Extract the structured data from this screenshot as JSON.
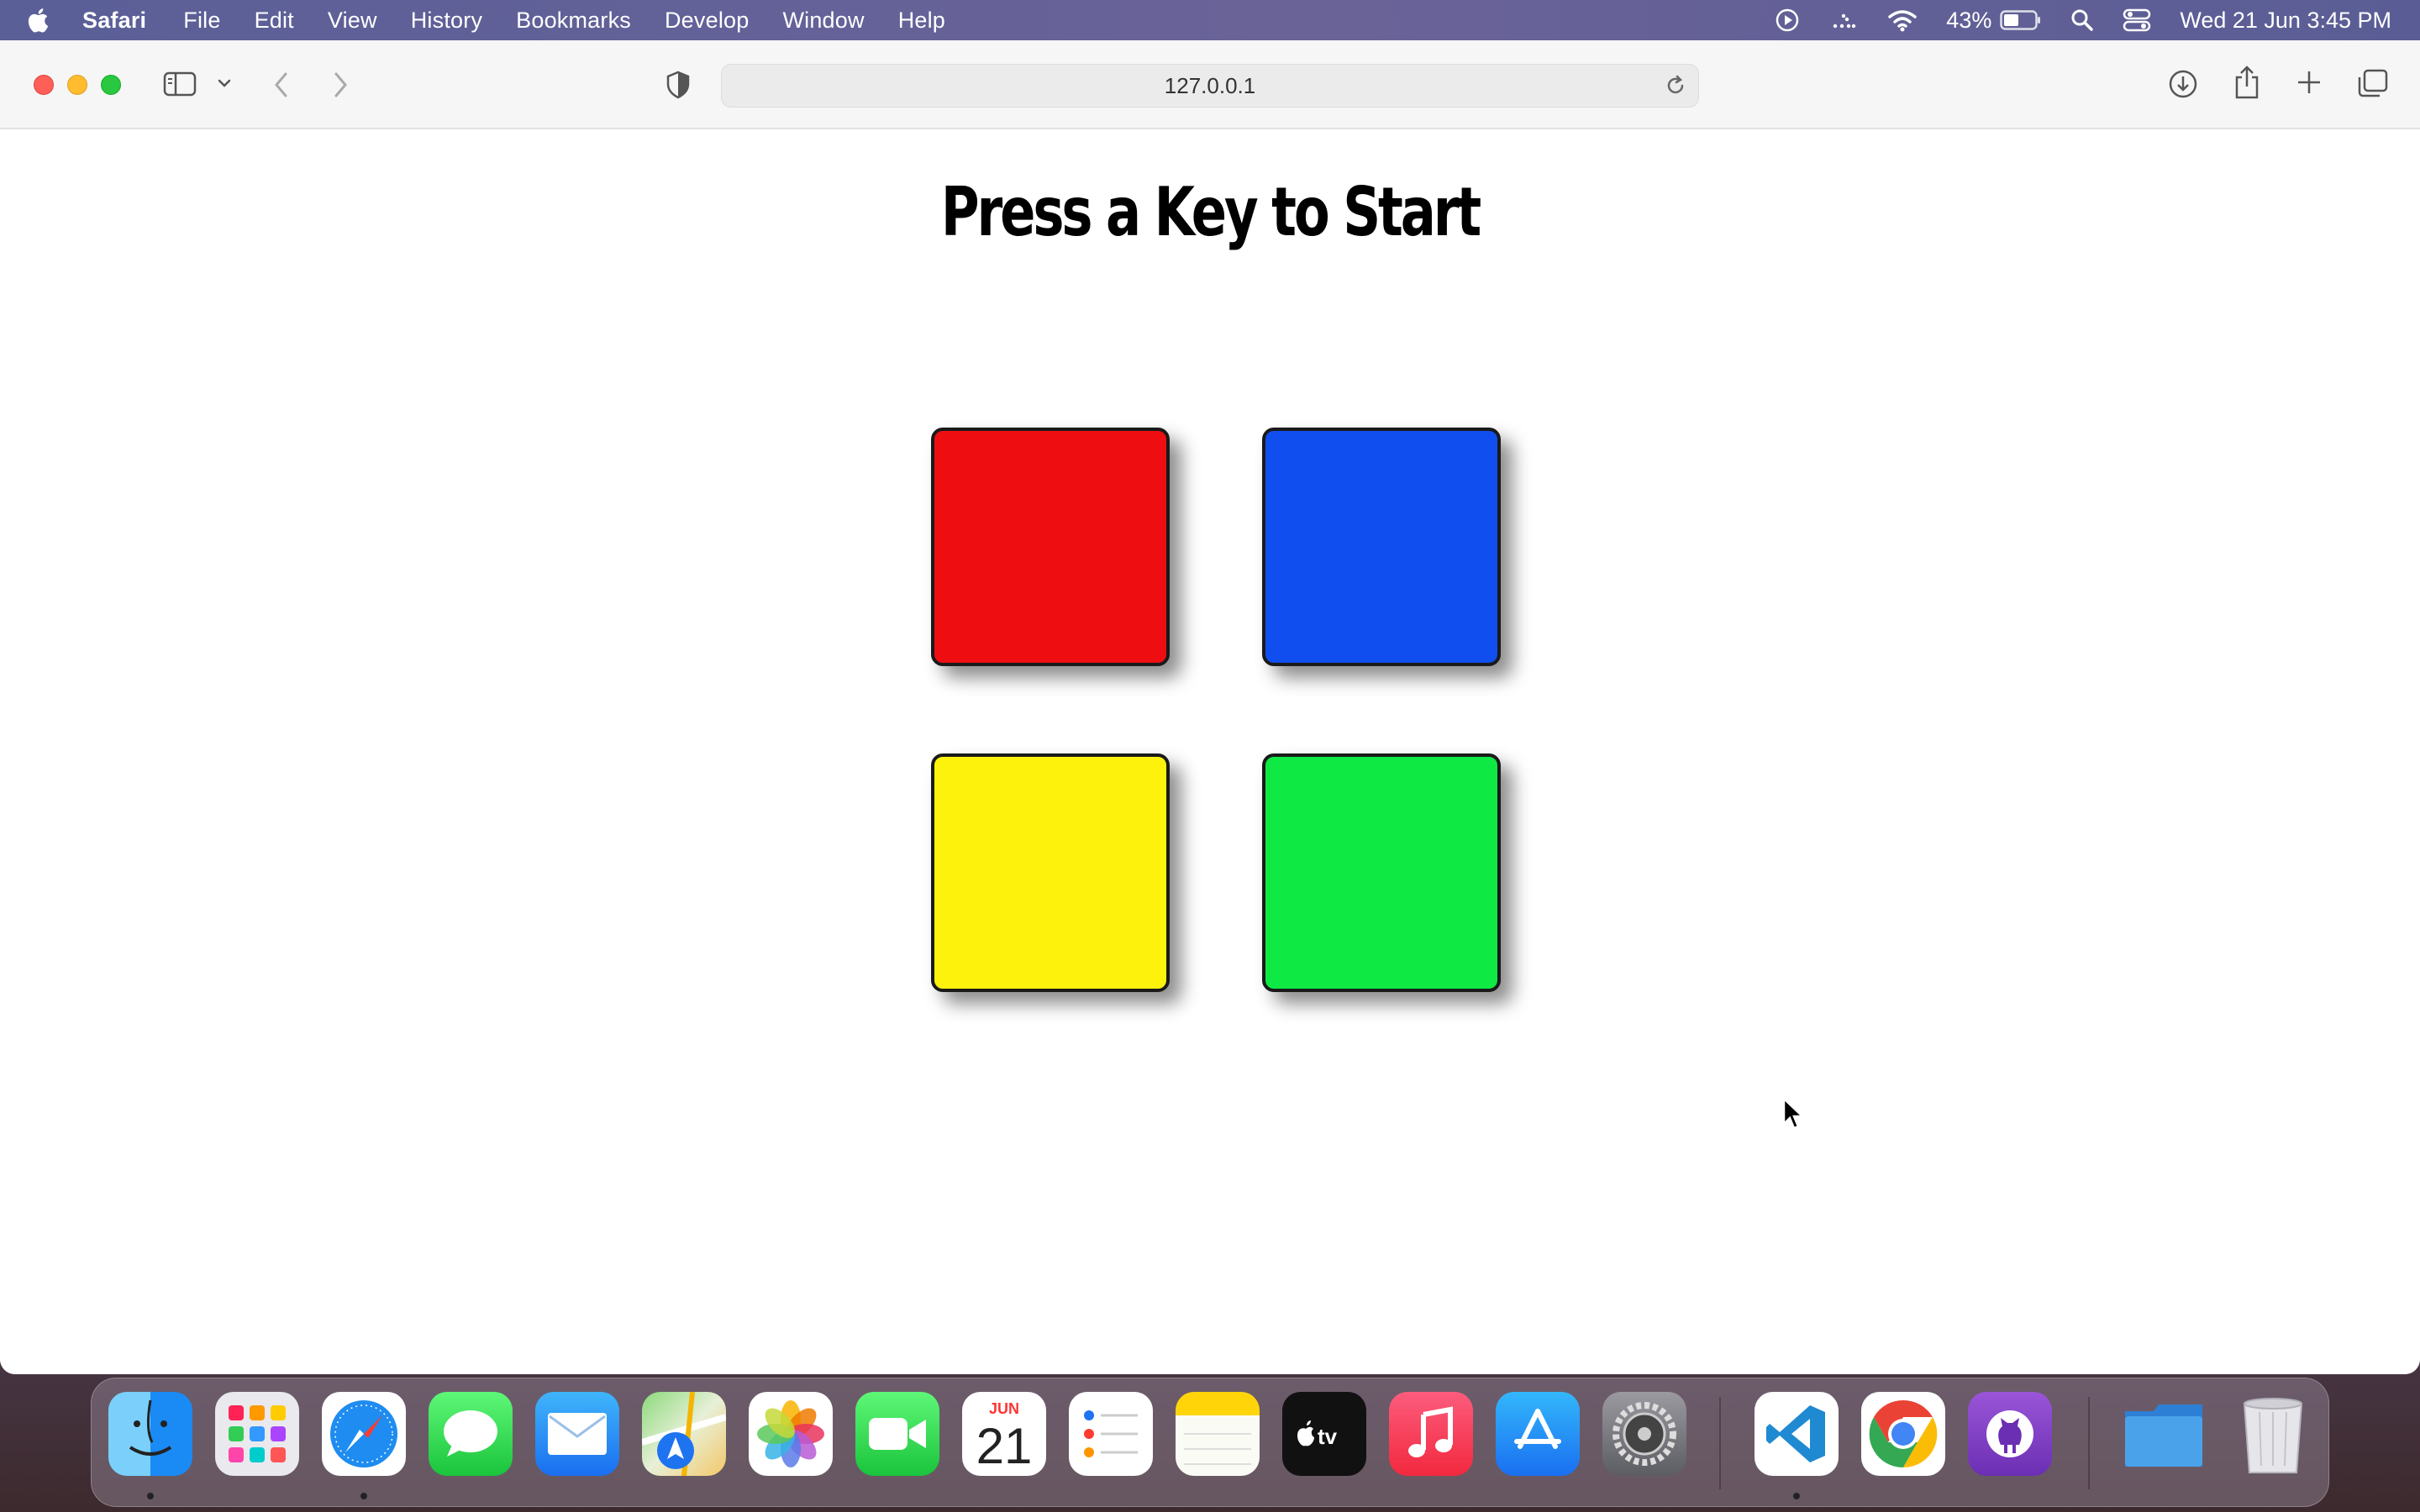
{
  "menubar": {
    "app_name": "Safari",
    "items": [
      "File",
      "Edit",
      "View",
      "History",
      "Bookmarks",
      "Develop",
      "Window",
      "Help"
    ],
    "battery_percent": "43%",
    "clock": "Wed 21 Jun  3:45 PM"
  },
  "browser": {
    "url": "127.0.0.1"
  },
  "game": {
    "title": "Press a Key to Start",
    "buttons": [
      {
        "color_name": "red",
        "color": "#ee0e12"
      },
      {
        "color_name": "blue",
        "color": "#114ef0"
      },
      {
        "color_name": "yellow",
        "color": "#fcf20b"
      },
      {
        "color_name": "green",
        "color": "#0ee944"
      }
    ]
  },
  "dock": {
    "calendar_month": "JUN",
    "calendar_day": "21",
    "apps": [
      "Finder",
      "Launchpad",
      "Safari",
      "Messages",
      "Mail",
      "Maps",
      "Photos",
      "FaceTime",
      "Calendar",
      "Reminders",
      "Notes",
      "Apple TV",
      "Music",
      "App Store",
      "System Settings",
      "Visual Studio Code",
      "Google Chrome",
      "GitHub Desktop",
      "Downloads",
      "Trash"
    ]
  }
}
